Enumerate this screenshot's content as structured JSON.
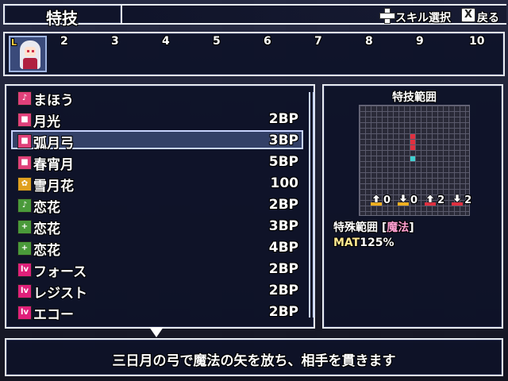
{
  "header": {
    "title": "特技",
    "hint_skill_label": "スキル選択",
    "hint_back_label": "戻る",
    "hint_back_key": "X"
  },
  "party": {
    "slot_letter": "L",
    "slot_numbers": [
      "2",
      "3",
      "4",
      "5",
      "6",
      "7",
      "8",
      "9",
      "10"
    ]
  },
  "skills": [
    {
      "name": "まほう",
      "cost": "",
      "icon": "magic-category-icon",
      "color": "#e0407a",
      "glyph": "♪"
    },
    {
      "name": "月光",
      "cost": "2BP",
      "icon": "pink-square-icon",
      "color": "#e0407a",
      "glyph": "■"
    },
    {
      "name": "弧月弓",
      "cost": "3BP",
      "icon": "pink-square-icon",
      "color": "#e0407a",
      "glyph": "■"
    },
    {
      "name": "春宵月",
      "cost": "5BP",
      "icon": "pink-square-icon",
      "color": "#e0407a",
      "glyph": "■"
    },
    {
      "name": "雪月花",
      "cost": "100",
      "icon": "flower-icon",
      "color": "#e0a020",
      "glyph": "✿"
    },
    {
      "name": "恋花",
      "cost": "2BP",
      "icon": "green-note-icon",
      "color": "#4a9a3a",
      "glyph": "♪"
    },
    {
      "name": "恋花",
      "cost": "3BP",
      "icon": "green-plus-icon",
      "color": "#4a9a3a",
      "glyph": "+"
    },
    {
      "name": "恋花",
      "cost": "4BP",
      "icon": "green-plus-icon",
      "color": "#4a9a3a",
      "glyph": "+"
    },
    {
      "name": "フォース",
      "cost": "2BP",
      "icon": "level-icon",
      "color": "#e0207a",
      "glyph": "lv"
    },
    {
      "name": "レジスト",
      "cost": "2BP",
      "icon": "level-icon",
      "color": "#e0207a",
      "glyph": "lv"
    },
    {
      "name": "エコー",
      "cost": "2BP",
      "icon": "level-icon",
      "color": "#e0207a",
      "glyph": "lv"
    }
  ],
  "selected_index": 2,
  "range": {
    "title": "特技範囲",
    "type_label": "特殊範囲 [",
    "type_value": "魔法",
    "type_close": "]",
    "mat_label": "MAT",
    "mat_value": "125%",
    "arrows": [
      {
        "dir": "up",
        "value": "0",
        "color": "#f0b020"
      },
      {
        "dir": "down",
        "value": "0",
        "color": "#f0b020"
      },
      {
        "dir": "up",
        "value": "2",
        "color": "#e03040"
      },
      {
        "dir": "down",
        "value": "2",
        "color": "#e03040"
      }
    ]
  },
  "description": "三日月の弓で魔法の矢を放ち、相手を貫きます"
}
